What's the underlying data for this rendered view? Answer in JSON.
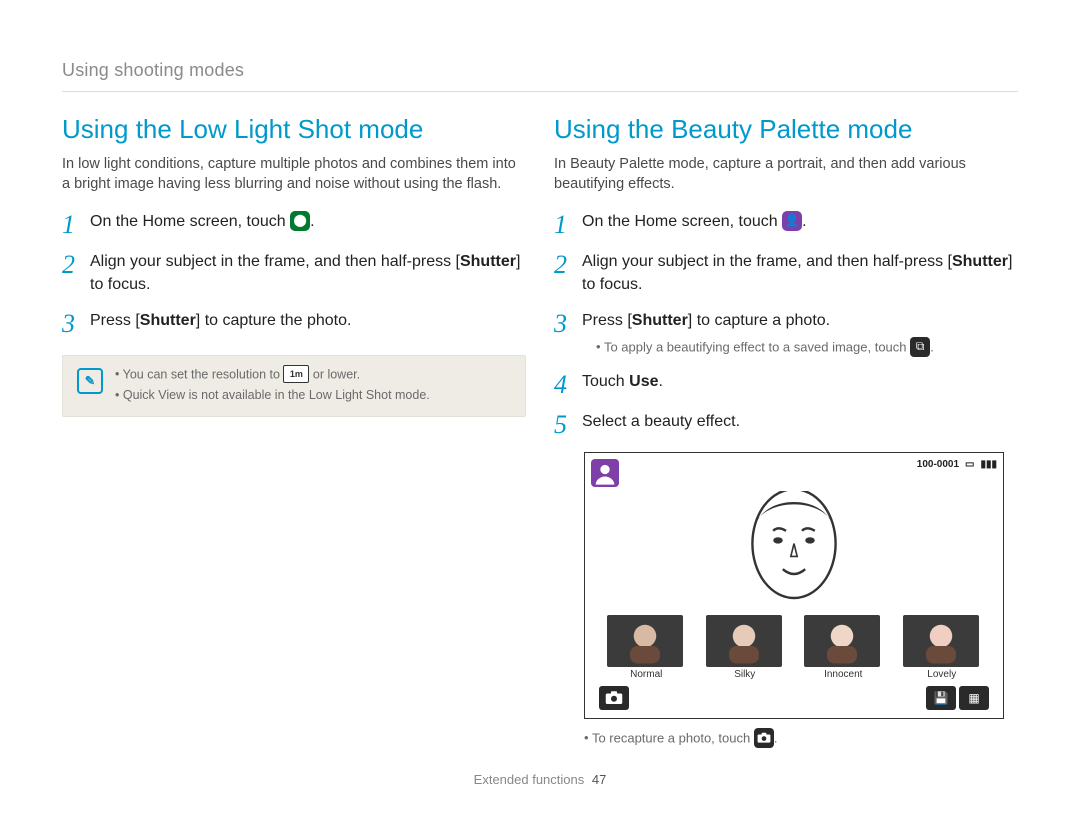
{
  "breadcrumb": "Using shooting modes",
  "footer": {
    "section": "Extended functions",
    "page": "47"
  },
  "icons": {
    "note": "✎",
    "low_light": "⬤",
    "beauty": "👤",
    "resolution": "1m",
    "gallery": "⧉",
    "camera": "📷",
    "save_disk": "💾",
    "grid": "▦",
    "battery": "▮▮▮",
    "card": "▭"
  },
  "left": {
    "title": "Using the Low Light Shot mode",
    "intro": "In low light conditions, capture multiple photos and combines them into a bright image having less blurring and noise without using the flash.",
    "steps": [
      {
        "num": "1",
        "pre": "On the Home screen, touch ",
        "icon": "low_light",
        "post": "."
      },
      {
        "num": "2",
        "pre": "Align your subject in the frame, and then half-press [",
        "bold": "Shutter",
        "post": "] to focus."
      },
      {
        "num": "3",
        "pre": "Press [",
        "bold": "Shutter",
        "post": "] to capture the photo."
      }
    ],
    "note": [
      {
        "pre": "You can set the resolution to ",
        "icon": "resolution",
        "post": " or lower."
      },
      {
        "text": "Quick View is not available in the Low Light Shot mode."
      }
    ]
  },
  "right": {
    "title": "Using the Beauty Palette mode",
    "intro": "In Beauty Palette mode, capture a portrait, and then add various beautifying effects.",
    "steps": [
      {
        "num": "1",
        "pre": "On the Home screen, touch ",
        "icon": "beauty",
        "post": "."
      },
      {
        "num": "2",
        "pre": "Align your subject in the frame, and then half-press [",
        "bold": "Shutter",
        "post": "] to focus."
      },
      {
        "num": "3",
        "pre": "Press [",
        "bold": "Shutter",
        "post": "] to capture a photo.",
        "sub": [
          {
            "pre": "To apply a beautifying effect to a saved image, touch ",
            "icon": "gallery",
            "post": "."
          }
        ]
      },
      {
        "num": "4",
        "pre": "Touch ",
        "bold": "Use",
        "post": "."
      },
      {
        "num": "5",
        "pre": "Select a beauty effect."
      }
    ],
    "after_sub": [
      {
        "pre": "To recapture a photo, touch ",
        "icon": "camera",
        "post": "."
      }
    ],
    "palette": {
      "status_text": "100-0001",
      "options": [
        "Normal",
        "Silky",
        "Innocent",
        "Lovely"
      ]
    }
  }
}
